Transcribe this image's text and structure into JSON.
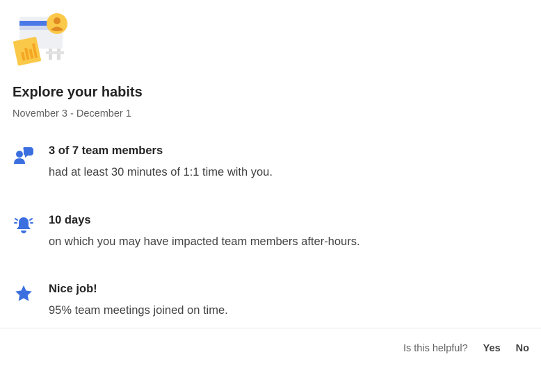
{
  "card": {
    "title": "Explore your habits",
    "date_range": "November 3 - December 1"
  },
  "insights": [
    {
      "icon": "people-chat-icon",
      "headline": "3 of 7 team members",
      "detail": "had at least 30 minutes of 1:1 time with you."
    },
    {
      "icon": "alert-bell-icon",
      "headline": "10 days",
      "detail": "on which you may have impacted team members after-hours."
    },
    {
      "icon": "star-icon",
      "headline": "Nice job!",
      "detail": "95% team meetings joined on time."
    }
  ],
  "feedback": {
    "question": "Is this helpful?",
    "yes_label": "Yes",
    "no_label": "No"
  },
  "colors": {
    "accent_blue": "#3b6fe0",
    "illustration_yellow": "#fbc94a",
    "text_primary": "#242424",
    "text_secondary": "#616161"
  }
}
